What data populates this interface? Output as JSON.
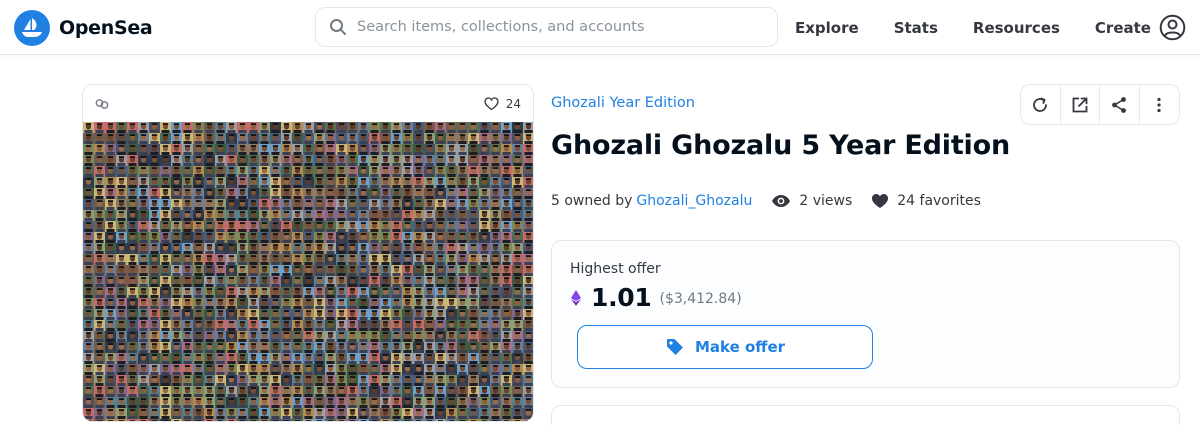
{
  "brand": {
    "name": "OpenSea",
    "logo_icon": "opensea-logo-icon",
    "color": "#2081e2"
  },
  "search": {
    "placeholder": "Search items, collections, and accounts",
    "value": ""
  },
  "nav": {
    "explore": "Explore",
    "stats": "Stats",
    "resources": "Resources",
    "create": "Create"
  },
  "card": {
    "favorite_count": "24"
  },
  "item": {
    "collection": "Ghozali Year Edition",
    "title": "Ghozali Ghozalu 5 Year Edition",
    "owned_prefix": "5 owned by",
    "owner": "Ghozali_Ghozalu",
    "views": "2 views",
    "favorites": "24 favorites"
  },
  "actions": [
    "refresh-icon",
    "external-link-icon",
    "share-icon",
    "more-icon"
  ],
  "offer": {
    "label": "Highest offer",
    "price": "1.01",
    "usd": "($3,412.84)",
    "button_label": "Make offer",
    "eth_color": "#8247e5"
  }
}
